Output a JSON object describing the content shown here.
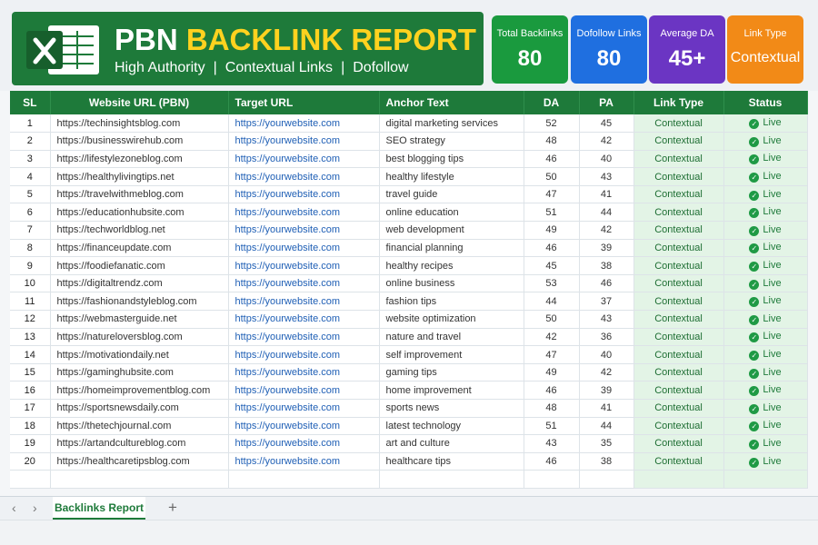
{
  "header": {
    "title_pbn": "PBN",
    "title_rest": "BACKLINK REPORT",
    "subtitle_items": [
      "High Authority",
      "Contextual Links",
      "Dofollow"
    ],
    "separator": "|"
  },
  "cards": {
    "total": {
      "label": "Total Backlinks",
      "value": "80",
      "color": "#1a9a3e"
    },
    "dofollow": {
      "label": "Dofollow Links",
      "value": "80",
      "color": "#1f6fe0"
    },
    "avg_da": {
      "label": "Average DA",
      "value": "45+",
      "color": "#6b35c3"
    },
    "link_type": {
      "label": "Link Type",
      "value": "Contextual",
      "color": "#f28a17"
    }
  },
  "table": {
    "columns": [
      "SL",
      "Website URL (PBN)",
      "Target URL",
      "Anchor Text",
      "DA",
      "PA",
      "Link Type",
      "Status"
    ],
    "rows": [
      {
        "sl": "1",
        "site": "https://techinsightsblog.com",
        "target": "https://yourwebsite.com",
        "anchor": "digital marketing services",
        "da": "52",
        "pa": "45",
        "type": "Contextual",
        "status": "Live"
      },
      {
        "sl": "2",
        "site": "https://businesswirehub.com",
        "target": "https://yourwebsite.com",
        "anchor": "SEO strategy",
        "da": "48",
        "pa": "42",
        "type": "Contextual",
        "status": "Live"
      },
      {
        "sl": "3",
        "site": "https://lifestylezoneblog.com",
        "target": "https://yourwebsite.com",
        "anchor": "best blogging tips",
        "da": "46",
        "pa": "40",
        "type": "Contextual",
        "status": "Live"
      },
      {
        "sl": "4",
        "site": "https://healthylivingtips.net",
        "target": "https://yourwebsite.com",
        "anchor": "healthy lifestyle",
        "da": "50",
        "pa": "43",
        "type": "Contextual",
        "status": "Live"
      },
      {
        "sl": "5",
        "site": "https://travelwithmeblog.com",
        "target": "https://yourwebsite.com",
        "anchor": "travel guide",
        "da": "47",
        "pa": "41",
        "type": "Contextual",
        "status": "Live"
      },
      {
        "sl": "6",
        "site": "https://educationhubsite.com",
        "target": "https://yourwebsite.com",
        "anchor": "online education",
        "da": "51",
        "pa": "44",
        "type": "Contextual",
        "status": "Live"
      },
      {
        "sl": "7",
        "site": "https://techworldblog.net",
        "target": "https://yourwebsite.com",
        "anchor": "web development",
        "da": "49",
        "pa": "42",
        "type": "Contextual",
        "status": "Live"
      },
      {
        "sl": "8",
        "site": "https://financeupdate.com",
        "target": "https://yourwebsite.com",
        "anchor": "financial planning",
        "da": "46",
        "pa": "39",
        "type": "Contextual",
        "status": "Live"
      },
      {
        "sl": "9",
        "site": "https://foodiefanatic.com",
        "target": "https://yourwebsite.com",
        "anchor": "healthy recipes",
        "da": "45",
        "pa": "38",
        "type": "Contextual",
        "status": "Live"
      },
      {
        "sl": "10",
        "site": "https://digitaltrendz.com",
        "target": "https://yourwebsite.com",
        "anchor": "online business",
        "da": "53",
        "pa": "46",
        "type": "Contextual",
        "status": "Live"
      },
      {
        "sl": "11",
        "site": "https://fashionandstyleblog.com",
        "target": "https://yourwebsite.com",
        "anchor": "fashion tips",
        "da": "44",
        "pa": "37",
        "type": "Contextual",
        "status": "Live"
      },
      {
        "sl": "12",
        "site": "https://webmasterguide.net",
        "target": "https://yourwebsite.com",
        "anchor": "website optimization",
        "da": "50",
        "pa": "43",
        "type": "Contextual",
        "status": "Live"
      },
      {
        "sl": "13",
        "site": "https://natureloversblog.com",
        "target": "https://yourwebsite.com",
        "anchor": "nature and travel",
        "da": "42",
        "pa": "36",
        "type": "Contextual",
        "status": "Live"
      },
      {
        "sl": "14",
        "site": "https://motivationdaily.net",
        "target": "https://yourwebsite.com",
        "anchor": "self improvement",
        "da": "47",
        "pa": "40",
        "type": "Contextual",
        "status": "Live"
      },
      {
        "sl": "15",
        "site": "https://gaminghubsite.com",
        "target": "https://yourwebsite.com",
        "anchor": "gaming tips",
        "da": "49",
        "pa": "42",
        "type": "Contextual",
        "status": "Live"
      },
      {
        "sl": "16",
        "site": "https://homeimprovementblog.com",
        "target": "https://yourwebsite.com",
        "anchor": "home improvement",
        "da": "46",
        "pa": "39",
        "type": "Contextual",
        "status": "Live"
      },
      {
        "sl": "17",
        "site": "https://sportsnewsdaily.com",
        "target": "https://yourwebsite.com",
        "anchor": "sports news",
        "da": "48",
        "pa": "41",
        "type": "Contextual",
        "status": "Live"
      },
      {
        "sl": "18",
        "site": "https://thetechjournal.com",
        "target": "https://yourwebsite.com",
        "anchor": "latest technology",
        "da": "51",
        "pa": "44",
        "type": "Contextual",
        "status": "Live"
      },
      {
        "sl": "19",
        "site": "https://artandcultureblog.com",
        "target": "https://yourwebsite.com",
        "anchor": "art and culture",
        "da": "43",
        "pa": "35",
        "type": "Contextual",
        "status": "Live"
      },
      {
        "sl": "20",
        "site": "https://healthcaretipsblog.com",
        "target": "https://yourwebsite.com",
        "anchor": "healthcare tips",
        "da": "46",
        "pa": "38",
        "type": "Contextual",
        "status": "Live"
      }
    ]
  },
  "sheet_tabs": {
    "active": "Backlinks Report",
    "prev_icon": "‹",
    "next_icon": "›",
    "add_icon": "+"
  },
  "colors": {
    "brand_green": "#1e7a3a",
    "title_yellow": "#ffd21f",
    "link_blue": "#1f5fb5",
    "live_green": "#1f9a45"
  }
}
